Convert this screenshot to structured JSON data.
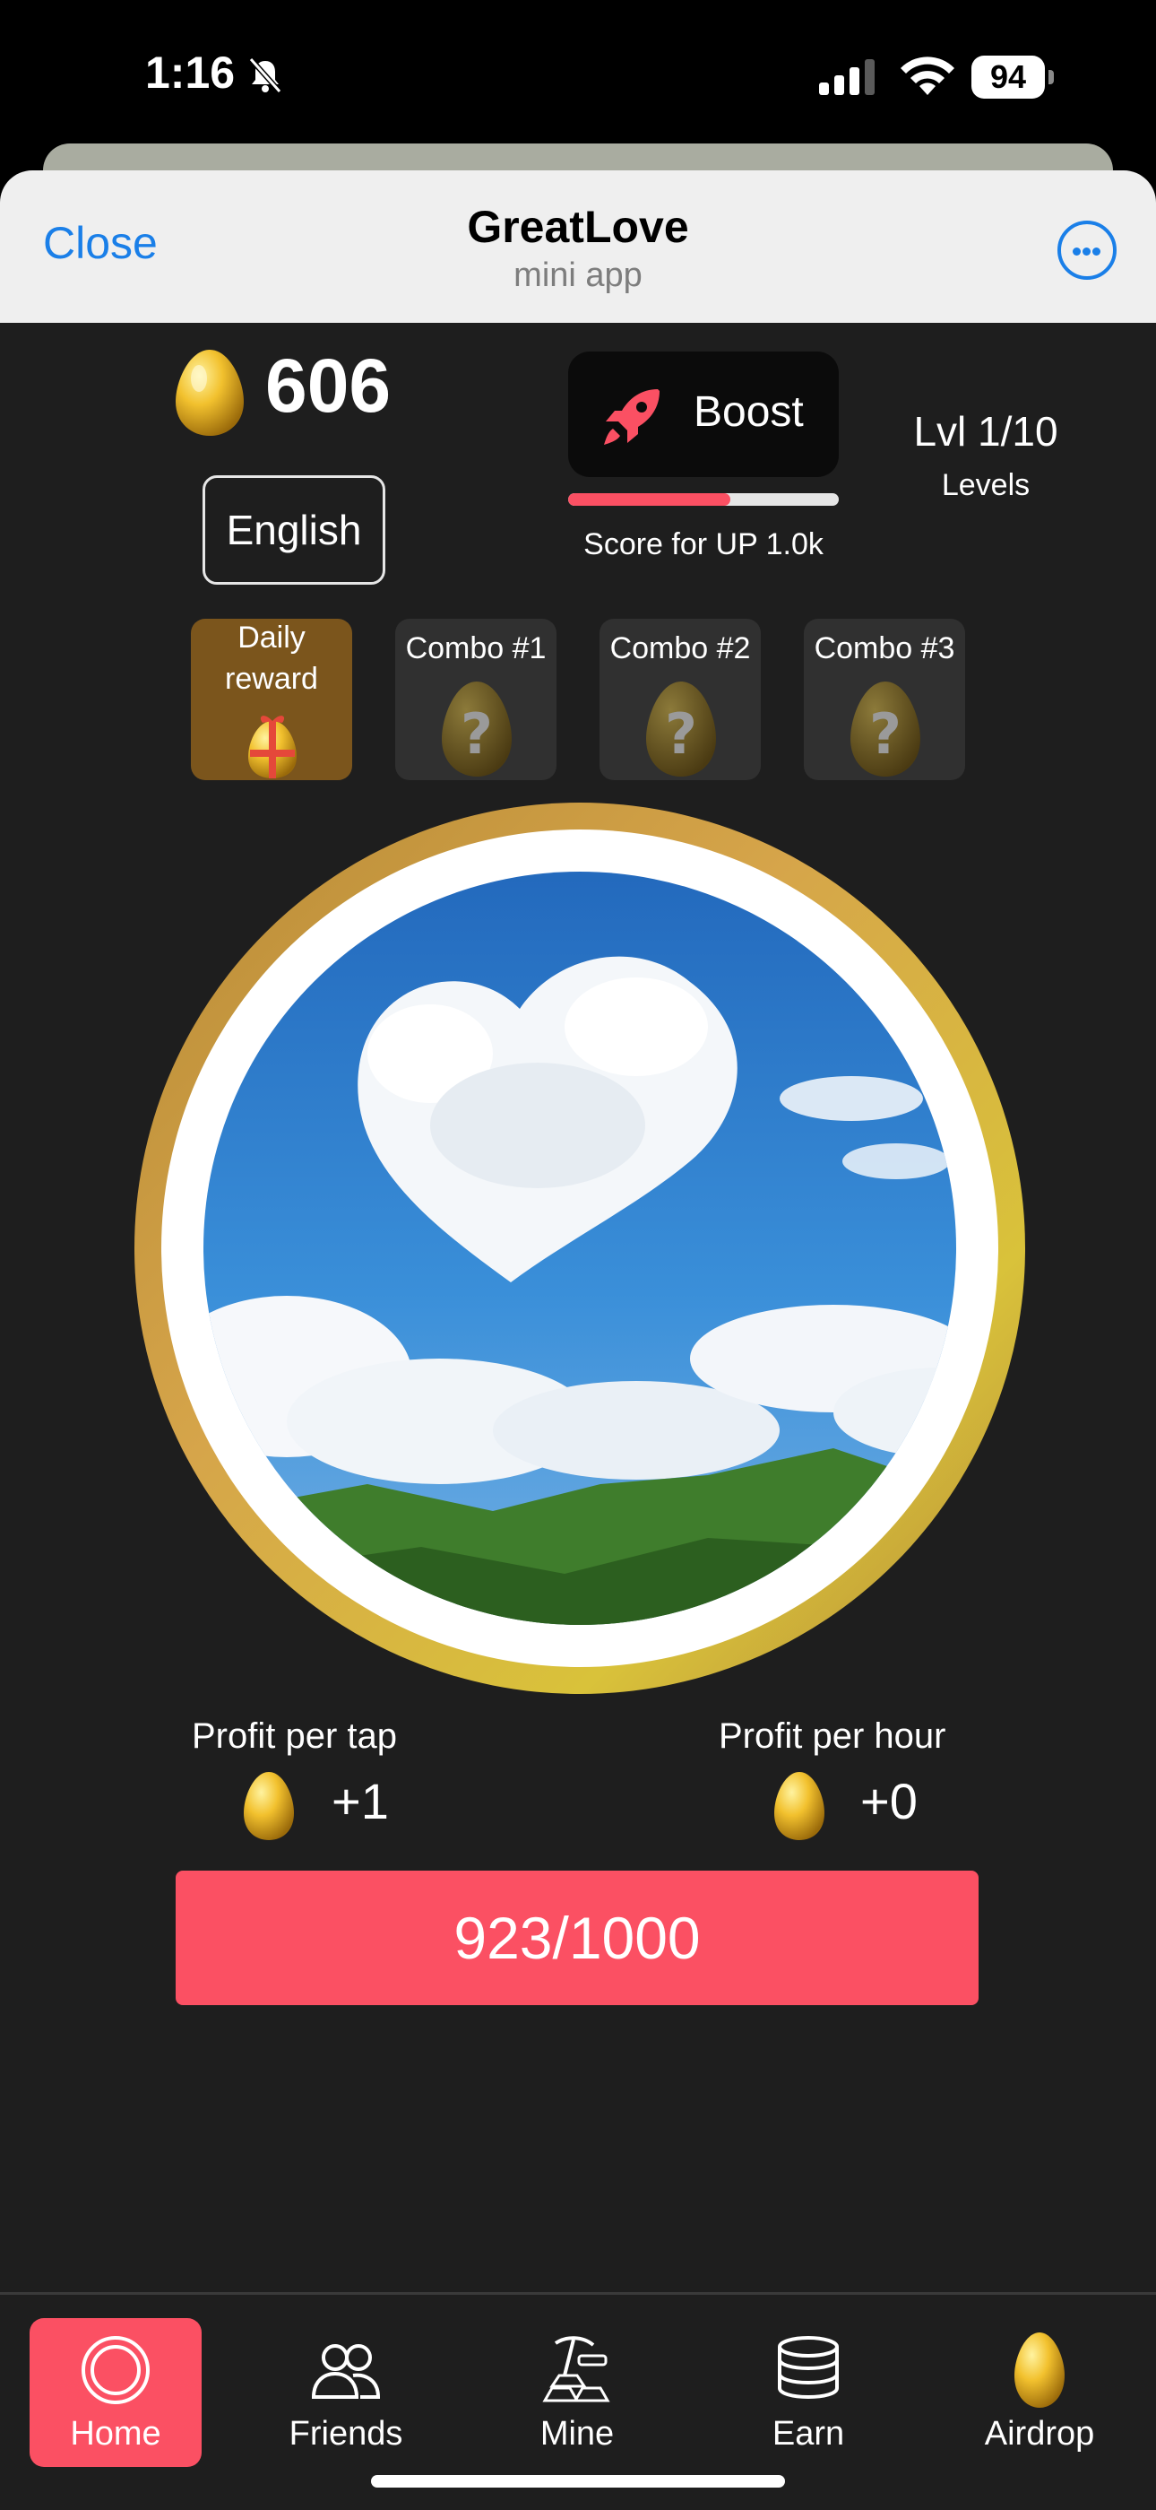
{
  "status_bar": {
    "time": "1:16",
    "battery": "94",
    "icons": [
      "bell-off-icon",
      "signal-icon",
      "wifi-icon",
      "battery-icon"
    ]
  },
  "header": {
    "close_label": "Close",
    "title": "GreatLove",
    "subtitle": "mini app",
    "more_icon": "more-icon"
  },
  "balance": {
    "value": "606",
    "icon": "egg-icon"
  },
  "language": {
    "label": "English"
  },
  "boost": {
    "label": "Boost",
    "icon": "rocket-icon",
    "progress": 0.6,
    "score_label": "Score for UP 1.0k"
  },
  "level": {
    "label": "Lvl 1/10",
    "link": "Levels"
  },
  "tiles": {
    "daily": {
      "line1": "Daily",
      "line2": "reward",
      "icon": "gift-egg-icon"
    },
    "combos": [
      {
        "label": "Combo #1",
        "icon": "question-egg-icon"
      },
      {
        "label": "Combo #2",
        "icon": "question-egg-icon"
      },
      {
        "label": "Combo #3",
        "icon": "question-egg-icon"
      }
    ]
  },
  "tapper": {
    "image": "heart-cloud-sky-image"
  },
  "profit": {
    "per_tap": {
      "label": "Profit per tap",
      "value": "+1"
    },
    "per_hour": {
      "label": "Profit per hour",
      "value": "+0"
    }
  },
  "energy": {
    "label": "923/1000"
  },
  "nav": [
    {
      "label": "Home",
      "icon": "home-icon",
      "active": true
    },
    {
      "label": "Friends",
      "icon": "friends-icon",
      "active": false
    },
    {
      "label": "Mine",
      "icon": "mine-icon",
      "active": false
    },
    {
      "label": "Earn",
      "icon": "coins-icon",
      "active": false
    },
    {
      "label": "Airdrop",
      "icon": "egg-icon",
      "active": false
    }
  ],
  "colors": {
    "accent": "#fb5063",
    "link": "#1a7fe8",
    "background": "#1e1e1e",
    "gold": "#d9a93a"
  }
}
